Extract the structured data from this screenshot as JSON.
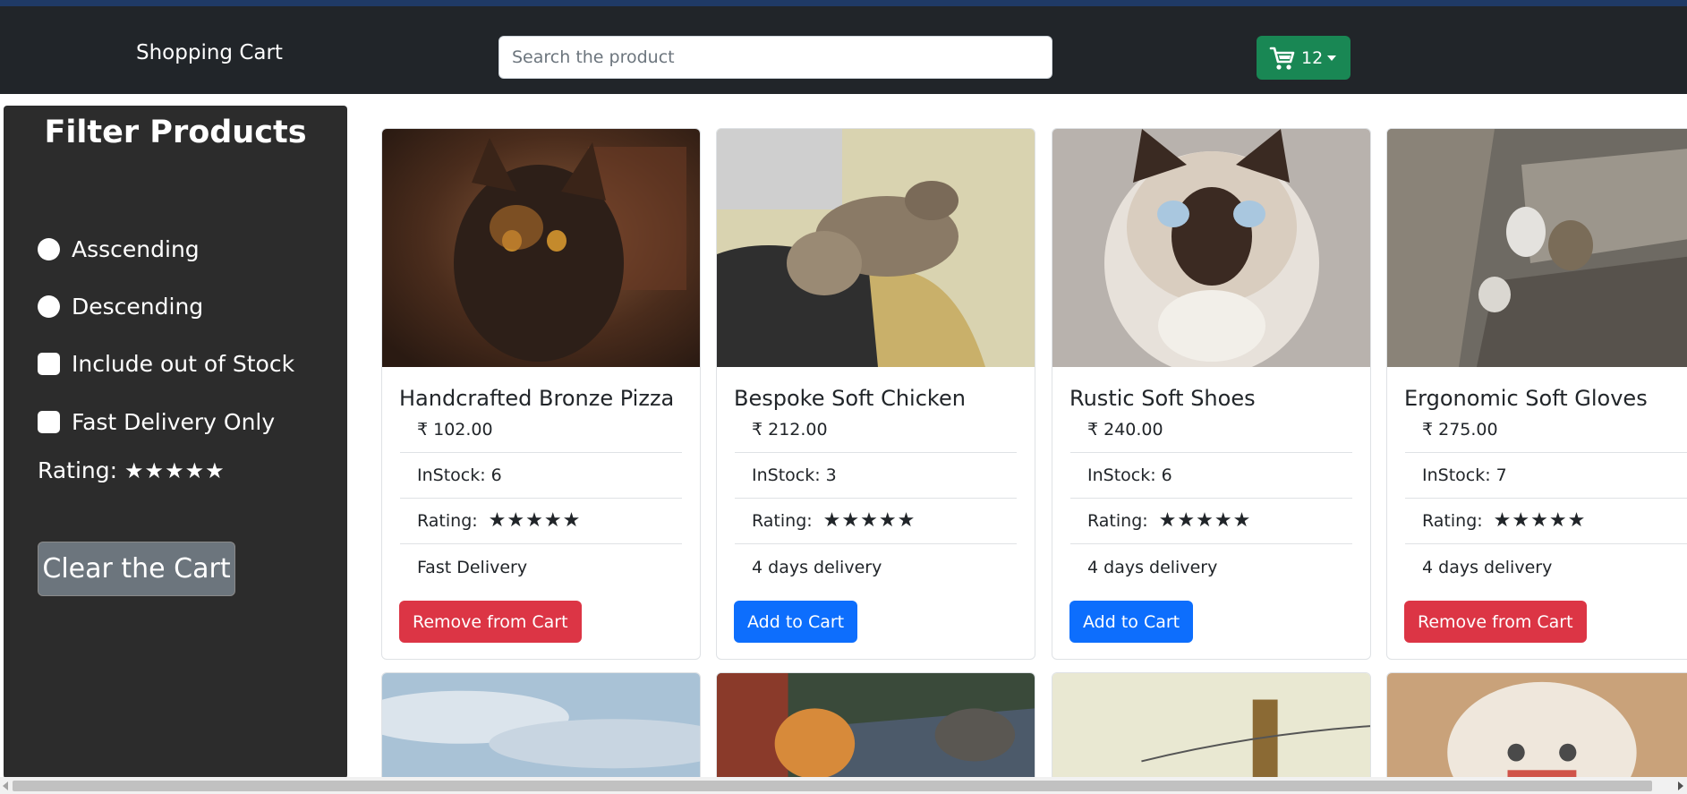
{
  "navbar": {
    "brand": "Shopping Cart",
    "search_placeholder": "Search the product",
    "cart_count": "12",
    "cart_color": "#198754"
  },
  "sidebar": {
    "title": "Filter Products",
    "ascending": "Asscending",
    "descending": "Descending",
    "include_out_of_stock": "Include out of Stock",
    "fast_delivery_only": "Fast Delivery Only",
    "rating_label": "Rating:",
    "rating_stars": 5,
    "clear_button": "Clear the Cart"
  },
  "products": [
    {
      "name": "Handcrafted Bronze Pizza",
      "price": "₹ 102.00",
      "stock": "InStock: 6",
      "rating_label": "Rating:",
      "rating": 5,
      "delivery": "Fast Delivery",
      "button": "Remove from Cart",
      "button_type": "remove",
      "image": "tortoiseshell-kitten-photo"
    },
    {
      "name": "Bespoke Soft Chicken",
      "price": "₹ 212.00",
      "stock": "InStock: 3",
      "rating_label": "Rating:",
      "rating": 5,
      "delivery": "4 days delivery",
      "button": "Add to Cart",
      "button_type": "add",
      "image": "sleeping-tabby-kitten-photo"
    },
    {
      "name": "Rustic Soft Shoes",
      "price": "₹ 240.00",
      "stock": "InStock: 6",
      "rating_label": "Rating:",
      "rating": 5,
      "delivery": "4 days delivery",
      "button": "Add to Cart",
      "button_type": "add",
      "image": "siamese-cat-photo"
    },
    {
      "name": "Ergonomic Soft Gloves",
      "price": "₹ 275.00",
      "stock": "InStock: 7",
      "rating_label": "Rating:",
      "rating": 5,
      "delivery": "4 days delivery",
      "button": "Remove from Cart",
      "button_type": "remove",
      "image": "kittens-on-rocks-photo"
    }
  ],
  "second_row_images": [
    "sky-clouds-photo",
    "cats-by-brick-wall-photo",
    "fence-post-photo",
    "kitten-in-box-photo"
  ],
  "colors": {
    "remove": "#dc3545",
    "add": "#0d6efd",
    "navbar": "#212529",
    "sidebar": "#2c2c2c"
  }
}
